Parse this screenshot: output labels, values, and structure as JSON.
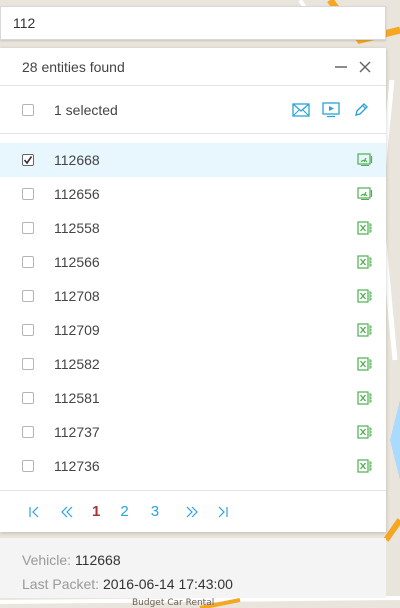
{
  "search": {
    "value": "112",
    "placeholder": ""
  },
  "panel": {
    "title": "28 entities found",
    "selection_label": "1 selected"
  },
  "list": [
    {
      "label": "112668",
      "checked": true,
      "icon": "gauge-icon"
    },
    {
      "label": "112656",
      "checked": false,
      "icon": "gauge-icon"
    },
    {
      "label": "112558",
      "checked": false,
      "icon": "spreadsheet-icon"
    },
    {
      "label": "112566",
      "checked": false,
      "icon": "spreadsheet-icon"
    },
    {
      "label": "112708",
      "checked": false,
      "icon": "spreadsheet-icon"
    },
    {
      "label": "112709",
      "checked": false,
      "icon": "spreadsheet-icon"
    },
    {
      "label": "112582",
      "checked": false,
      "icon": "spreadsheet-icon"
    },
    {
      "label": "112581",
      "checked": false,
      "icon": "spreadsheet-icon"
    },
    {
      "label": "112737",
      "checked": false,
      "icon": "spreadsheet-icon"
    },
    {
      "label": "112736",
      "checked": false,
      "icon": "spreadsheet-icon"
    }
  ],
  "pager": {
    "pages": [
      "1",
      "2",
      "3"
    ],
    "current": "1"
  },
  "info": {
    "vehicle_key": "Vehicle:",
    "vehicle_value": "112668",
    "packet_key": "Last Packet:",
    "packet_value": "2016-06-14 17:43:00"
  },
  "map": {
    "bottom_label": "Budget Car Rental"
  },
  "colors": {
    "accent": "#2aa3d8",
    "icon_green": "#4caf50",
    "current_page": "#aa3333",
    "active_row": "#e8f6fd"
  }
}
